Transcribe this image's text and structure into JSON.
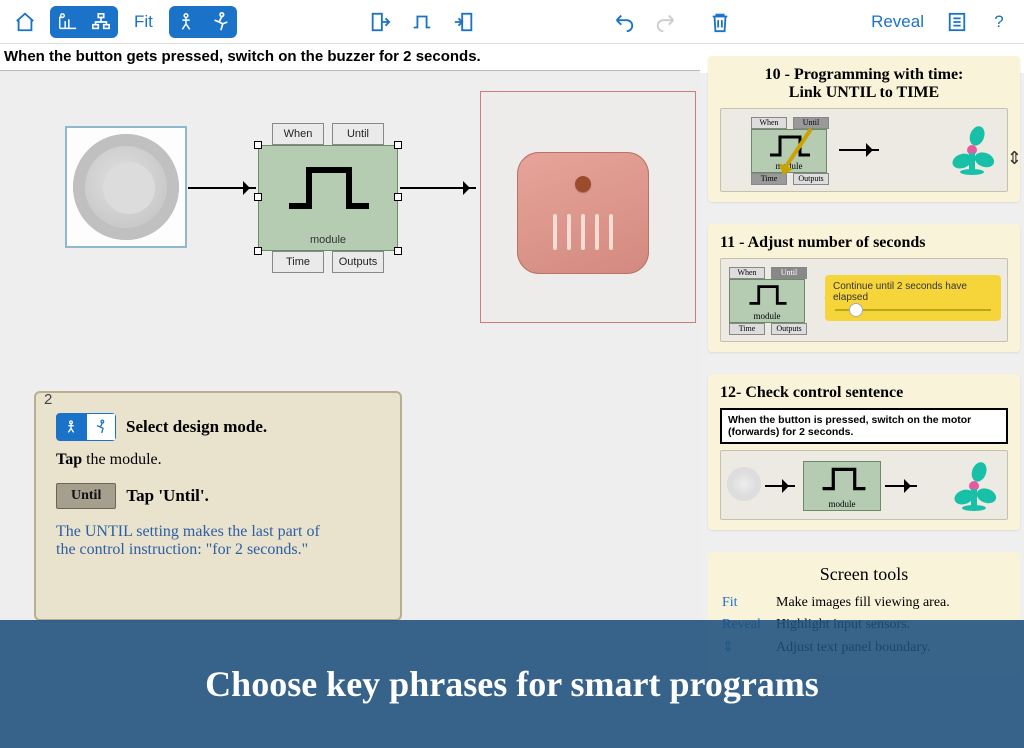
{
  "toolbar": {
    "fit_label": "Fit",
    "reveal_label": "Reveal",
    "help_label": "?"
  },
  "instruction": "When the button gets pressed, switch on the buzzer for 2 seconds.",
  "module": {
    "tab_when": "When",
    "tab_until": "Until",
    "tab_time": "Time",
    "tab_outputs": "Outputs",
    "label": "module"
  },
  "popover": {
    "number": "2",
    "line1": "Select design mode.",
    "line2_a": "Tap",
    "line2_b": " the module.",
    "until_chip": "Until",
    "line3": "Tap 'Until'.",
    "body1": "The UNTIL setting makes the last part of",
    "body2": "the control instruction: \"for 2 seconds.\""
  },
  "cards": {
    "c10": {
      "title": "10 - Programming with time:",
      "subtitle": "Link UNTIL to TIME",
      "tab_when": "When",
      "tab_until": "Until",
      "tab_time": "Time",
      "tab_outputs": "Outputs",
      "module": "module"
    },
    "c11": {
      "title": "11 - Adjust number of seconds",
      "banner": "Continue until  2  seconds have elapsed",
      "tab_when": "When",
      "tab_until": "Until",
      "tab_time": "Time",
      "tab_outputs": "Outputs",
      "module": "module"
    },
    "c12": {
      "title": "12- Check control sentence",
      "sentence": "When the button is pressed, switch on the motor (forwards) for 2 seconds.",
      "module": "module"
    },
    "tools": {
      "heading": "Screen tools",
      "fit_chip": "Fit",
      "fit_desc": "Make images fill viewing area.",
      "reveal_chip": "Reveal",
      "reveal_desc": "Highlight input sensors.",
      "adjust_desc": "Adjust text panel boundary."
    }
  },
  "overlay": "Choose key phrases for smart programs"
}
